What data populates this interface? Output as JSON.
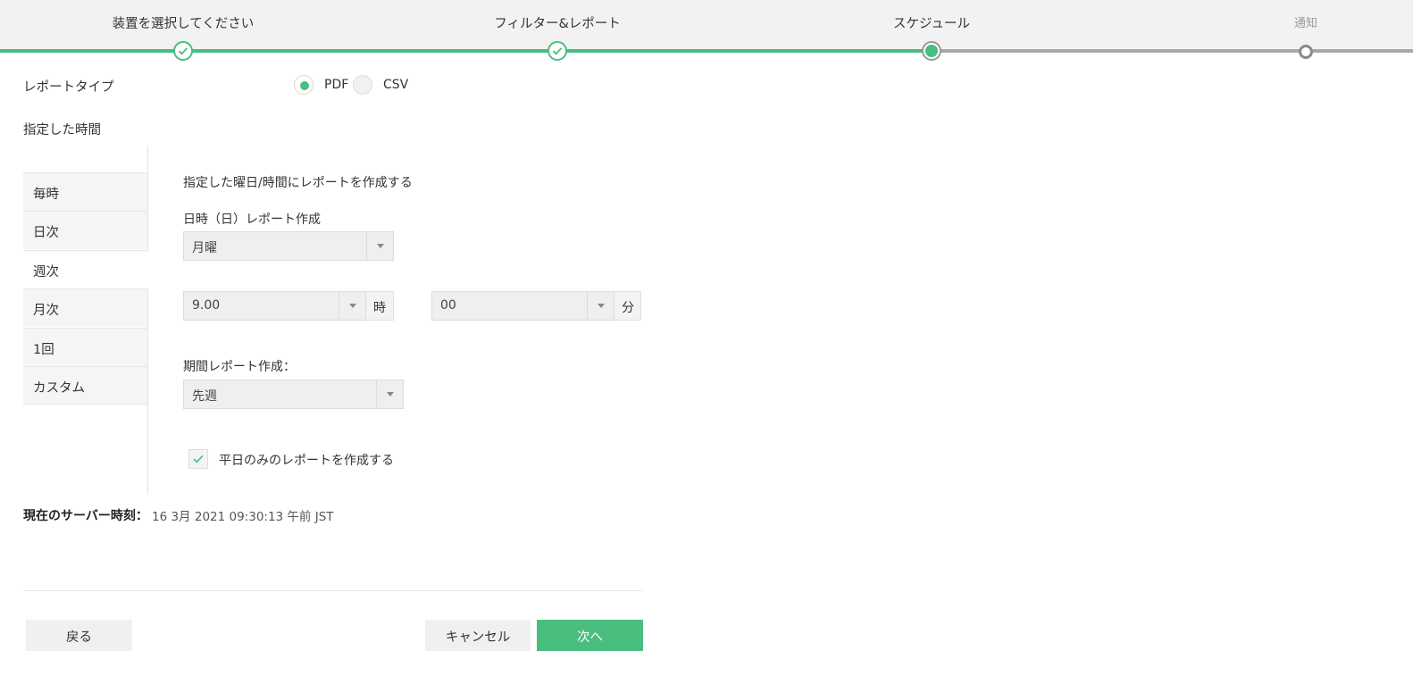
{
  "stepper": {
    "steps": [
      {
        "label": "装置を選択してください",
        "state": "done"
      },
      {
        "label": "フィルター&レポート",
        "state": "done"
      },
      {
        "label": "スケジュール",
        "state": "current"
      },
      {
        "label": "通知",
        "state": "todo"
      }
    ]
  },
  "report_type": {
    "label": "レポートタイプ",
    "options": [
      "PDF",
      "CSV"
    ],
    "selected": "PDF"
  },
  "schedule": {
    "label": "指定した時間",
    "tabs": [
      "毎時",
      "日次",
      "週次",
      "月次",
      "1回",
      "カスタム"
    ],
    "active_tab": "週次",
    "description": "指定した曜日/時間にレポートを作成する",
    "day_label": "日時（日）レポート作成",
    "day_value": "月曜",
    "hour_value": "9.00",
    "hour_unit": "時",
    "minute_value": "00",
    "minute_unit": "分",
    "period_label": "期間レポート作成：",
    "period_value": "先週",
    "weekdays_only_label": "平日のみのレポートを作成する",
    "weekdays_only_checked": true
  },
  "server_time": {
    "label": "現在のサーバー時刻：",
    "value": "16 3月 2021 09:30:13 午前 JST"
  },
  "buttons": {
    "back": "戻る",
    "cancel": "キャンセル",
    "next": "次へ"
  },
  "colors": {
    "accent": "#49be7e",
    "inactive": "#a8a8a8"
  }
}
